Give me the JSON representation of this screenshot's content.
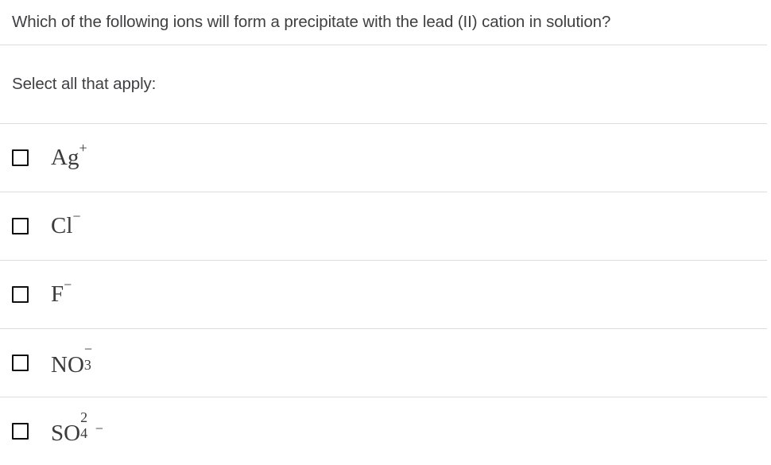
{
  "question": {
    "text": "Which of the following ions will form a precipitate with the lead (II) cation in solution?"
  },
  "prompt": {
    "text": "Select all that apply:"
  },
  "options": [
    {
      "id": "option-ag",
      "plain": "Ag+",
      "base": "Ag",
      "sup": "+",
      "sub": "",
      "form": "sup-only",
      "checked": false
    },
    {
      "id": "option-cl",
      "plain": "Cl−",
      "base": "Cl",
      "sup": "−",
      "sub": "",
      "form": "sup-only",
      "checked": false
    },
    {
      "id": "option-f",
      "plain": "F−",
      "base": "F",
      "sup": "−",
      "sub": "",
      "form": "sup-only",
      "checked": false
    },
    {
      "id": "option-no3",
      "plain": "NO3−",
      "base": "NO",
      "sup": "−",
      "sub": "3",
      "form": "stacked",
      "checked": false
    },
    {
      "id": "option-so4",
      "plain": "SO4 2−",
      "base": "SO",
      "sup": "2",
      "sub": "4",
      "charge": "−",
      "form": "stacked-charge",
      "checked": false
    }
  ],
  "colors": {
    "text": "#3f3f42",
    "divider": "#dcdcdc",
    "checkbox_border": "#111111",
    "background": "#ffffff"
  }
}
